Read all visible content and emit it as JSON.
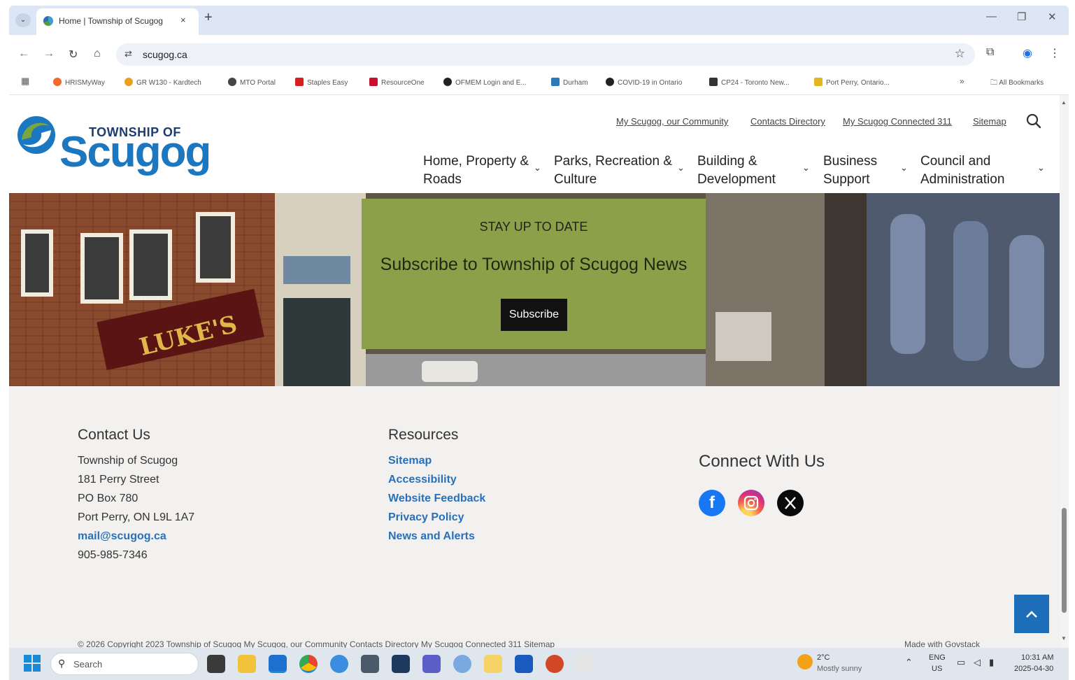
{
  "browser": {
    "tab_title": "Home | Township of Scugog",
    "tab_close": "×",
    "new_tab": "+",
    "url": "scugog.ca",
    "bookmarks": [
      "HRISMyWay",
      "GR W130 - Kardtech",
      "MTO Portal",
      "Staples Easy",
      "ResourceOne",
      "OFMEM Login and E...",
      "Durham",
      "COVID-19 in Ontario",
      "CP24 - Toronto New...",
      "Port Perry, Ontario..."
    ],
    "bookmarks_more": "»",
    "all_bookmarks": "All Bookmarks"
  },
  "site": {
    "logo_top": "TOWNSHIP OF",
    "logo_main": "Scugog",
    "util_links": [
      "My Scugog, our Community",
      "Contacts Directory",
      "My Scugog Connected 311",
      "Sitemap"
    ],
    "nav": [
      {
        "line1": "Home, Property &",
        "line2": "Roads"
      },
      {
        "line1": "Parks, Recreation &",
        "line2": "Culture"
      },
      {
        "line1": "Building &",
        "line2": "Development"
      },
      {
        "line1": "Business",
        "line2": "Support"
      },
      {
        "line1": "Council and",
        "line2": "Administration"
      }
    ],
    "hero": {
      "eyebrow": "STAY UP TO DATE",
      "title": "Subscribe to Township of Scugog News",
      "button": "Subscribe",
      "storefront_sign": "LUKE'S"
    },
    "footer": {
      "contact_heading": "Contact Us",
      "contact_lines": [
        "Township of Scugog",
        "181 Perry Street",
        "PO Box 780",
        "Port Perry, ON L9L 1A7"
      ],
      "contact_email": "mail@scugog.ca",
      "contact_phone": "905-985-7346",
      "resources_heading": "Resources",
      "resources_links": [
        "Sitemap",
        "Accessibility",
        "Website Feedback",
        "Privacy Policy",
        "News and Alerts"
      ],
      "connect_heading": "Connect With Us",
      "copyright": "© 2026 Copyright 2023 Township of Scugog   My Scugog, our Community   Contacts Directory   My Scugog Connected 311   Sitemap",
      "made_with": "Made with Govstack"
    }
  },
  "taskbar": {
    "search_placeholder": "Search",
    "weather_temp": "2°C",
    "weather_desc": "Mostly sunny",
    "lang_top": "ENG",
    "lang_bottom": "US",
    "time": "10:31 AM",
    "date": "2025-04-30"
  },
  "colors": {
    "subscribe_bg": "#8ca04a",
    "footer_bg": "#f2f1ef",
    "link_blue": "#2970b8",
    "back_to_top": "#1b6eb7"
  }
}
